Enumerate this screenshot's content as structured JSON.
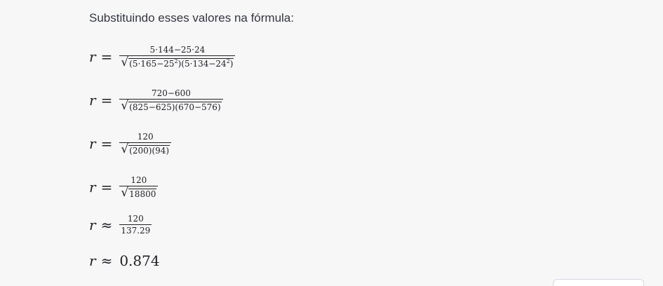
{
  "intro_text": "Substituindo esses valores na fórmula:",
  "equations": [
    {
      "var": "r",
      "op": "=",
      "numerator": "5·144−25·24",
      "radicand_parts": [
        "(5·165−25",
        "2",
        ")(5·134−24",
        "2",
        ")"
      ]
    },
    {
      "var": "r",
      "op": "=",
      "numerator": "720−600",
      "radicand": "(825−625)(670−576)"
    },
    {
      "var": "r",
      "op": "=",
      "numerator": "120",
      "radicand": "(200)(94)"
    },
    {
      "var": "r",
      "op": "=",
      "numerator": "120",
      "radicand": "18800"
    },
    {
      "var": "r",
      "op": "≈",
      "numerator": "120",
      "denominator": "137.29"
    },
    {
      "var": "r",
      "op": "≈",
      "value": "0.874"
    }
  ],
  "radical_symbol": "√"
}
